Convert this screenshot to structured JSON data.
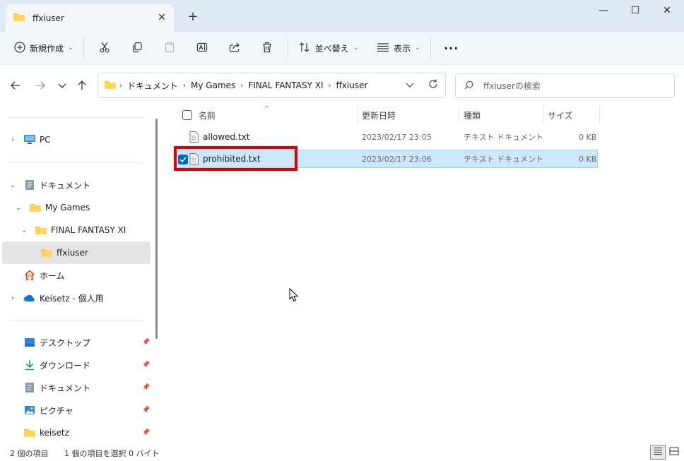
{
  "window": {
    "tab_title": "ffxiuser",
    "tab_close_glyph": "✕",
    "new_tab_glyph": "+",
    "minimize_glyph": "—",
    "maximize_glyph": "☐",
    "close_glyph": "✕"
  },
  "toolbar": {
    "new_label": "新規作成",
    "sort_label": "並べ替え",
    "view_label": "表示",
    "more_glyph": "···"
  },
  "address": {
    "crumbs": [
      "ドキュメント",
      "My Games",
      "FINAL FANTASY XI",
      "ffxiuser"
    ],
    "search_placeholder": "ffxiuserの検索"
  },
  "sidebar": {
    "items": [
      {
        "label": "PC",
        "icon": "pc-icon"
      },
      {
        "label": "ドキュメント",
        "icon": "documents-icon"
      },
      {
        "label": "My Games",
        "icon": "folder-icon"
      },
      {
        "label": "FINAL FANTASY XI",
        "icon": "folder-icon"
      },
      {
        "label": "ffxiuser",
        "icon": "folder-icon",
        "selected": true
      },
      {
        "label": "ホーム",
        "icon": "home-icon"
      },
      {
        "label": "Keisetz - 個人用",
        "icon": "onedrive-icon"
      }
    ],
    "quick_access": [
      {
        "label": "デスクトップ",
        "icon": "desktop-icon"
      },
      {
        "label": "ダウンロード",
        "icon": "download-icon"
      },
      {
        "label": "ドキュメント",
        "icon": "documents-icon"
      },
      {
        "label": "ピクチャ",
        "icon": "pictures-icon"
      },
      {
        "label": "keisetz",
        "icon": "folder-icon"
      }
    ]
  },
  "filelist": {
    "columns": [
      "名前",
      "更新日時",
      "種類",
      "サイズ"
    ],
    "sort_glyph": "^",
    "rows": [
      {
        "name": "allowed.txt",
        "modified": "2023/02/17 23:05",
        "type": "テキスト ドキュメント",
        "size": "0 KB",
        "selected": false
      },
      {
        "name": "prohibited.txt",
        "modified": "2023/02/17 23:06",
        "type": "テキスト ドキュメント",
        "size": "0 KB",
        "selected": true
      }
    ]
  },
  "status": {
    "item_count": "2 個の項目",
    "selection": "1 個の項目を選択  0 バイト"
  },
  "colors": {
    "accent": "#0067c0",
    "highlight_box": "#e00000",
    "selection_bg": "#cce8ff"
  }
}
